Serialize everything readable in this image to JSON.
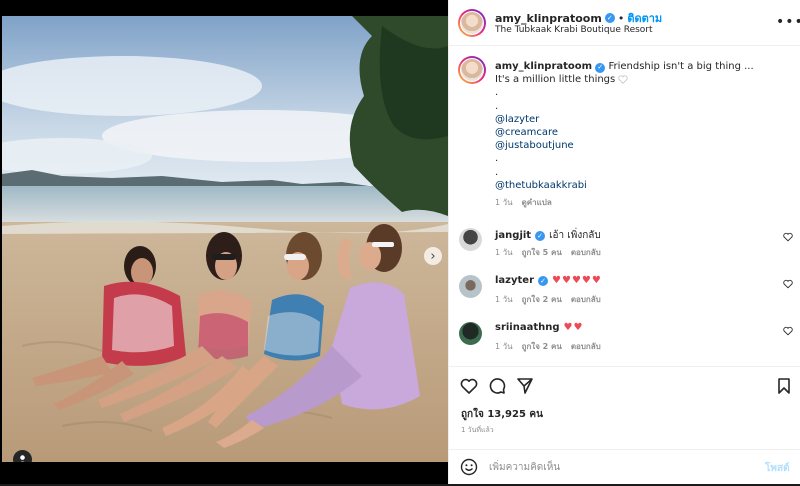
{
  "post": {
    "username": "amy_klinpratoom",
    "separator": "•",
    "follow_label": "ติดตาม",
    "location": "The Tubkaak Krabi Boutique Resort",
    "more_icon": "more-horizontal-icon",
    "carousel_next": "›"
  },
  "caption": {
    "username": "amy_klinpratoom",
    "text_line1": "Friendship isn't a big thing ...",
    "text_line2": "It's a million little things",
    "dot1": ".",
    "dot2": ".",
    "mentions": [
      "@lazyter",
      "@creamcare",
      "@justaboutjune"
    ],
    "dot3": ".",
    "dot4": ".",
    "mention_last": "@thetubkaakkrabi",
    "time": "1 วัน",
    "translate": "ดูคำแปล"
  },
  "comments": [
    {
      "username": "jangjit",
      "text": "เอ้า เพิ่งกลับ",
      "time": "1 วัน",
      "likes": "ถูกใจ 5 คน",
      "reply": "ตอบกลับ"
    },
    {
      "username": "lazyter",
      "text": "♥♥♥♥♥",
      "time": "1 วัน",
      "likes": "ถูกใจ 2 คน",
      "reply": "ตอบกลับ"
    },
    {
      "username": "sriinaathng",
      "text": "♥♥",
      "time": "1 วัน",
      "likes": "ถูกใจ 2 คน",
      "reply": "ตอบกลับ"
    }
  ],
  "actions": {
    "likes": "ถูกใจ 13,925 คน",
    "posted": "1 วันที่แล้ว"
  },
  "composer": {
    "placeholder": "เพิ่มความคิดเห็น",
    "post_label": "โพสต์"
  },
  "colors": {
    "accent": "#0095f6",
    "verified": "#3897f0",
    "mention": "#00376b",
    "heart": "#ed4956",
    "muted": "#8e8e8e"
  }
}
